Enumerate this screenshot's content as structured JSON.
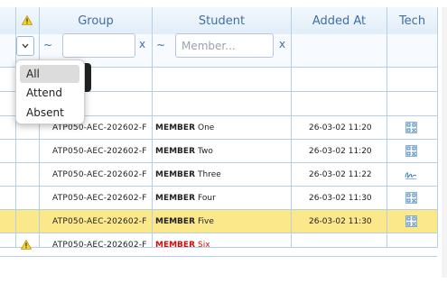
{
  "columns": {
    "group": "Group",
    "student": "Student",
    "added_at": "Added At",
    "tech": "Tech"
  },
  "filters": {
    "select_value": "",
    "tilde": "~",
    "clear": "x",
    "group_value": "",
    "member_placeholder": "Member..."
  },
  "dropdown": {
    "options": [
      "All",
      "Attend",
      "Absent"
    ],
    "selected": "All"
  },
  "rows": [
    {
      "group": "ATP050-AEC-202602-F",
      "member_bold": "MEMBER",
      "member_name": "One",
      "added_at": "26-03-02 11:20",
      "tech_icon": "qr-icon",
      "warning": false,
      "selected": false
    },
    {
      "group": "ATP050-AEC-202602-F",
      "member_bold": "MEMBER",
      "member_name": "Two",
      "added_at": "26-03-02 11:20",
      "tech_icon": "qr-icon",
      "warning": false,
      "selected": false
    },
    {
      "group": "ATP050-AEC-202602-F",
      "member_bold": "MEMBER",
      "member_name": "Three",
      "added_at": "26-03-02 11:22",
      "tech_icon": "signature-icon",
      "warning": false,
      "selected": false
    },
    {
      "group": "ATP050-AEC-202602-F",
      "member_bold": "MEMBER",
      "member_name": "Four",
      "added_at": "26-03-02 11:30",
      "tech_icon": "qr-icon",
      "warning": false,
      "selected": false
    },
    {
      "group": "ATP050-AEC-202602-F",
      "member_bold": "MEMBER",
      "member_name": "Five",
      "added_at": "26-03-02 11:30",
      "tech_icon": "qr-icon",
      "warning": false,
      "selected": true
    },
    {
      "group": "ATP050-AEC-202602-F",
      "member_bold": "MEMBER",
      "member_name": "Six",
      "added_at": "",
      "tech_icon": "",
      "warning": true,
      "selected": false
    }
  ],
  "colors": {
    "header_text": "#3e6fa5",
    "grid_line": "#b5cfe6",
    "selected_row": "#fbe88a",
    "warning_member": "#cc1010"
  }
}
